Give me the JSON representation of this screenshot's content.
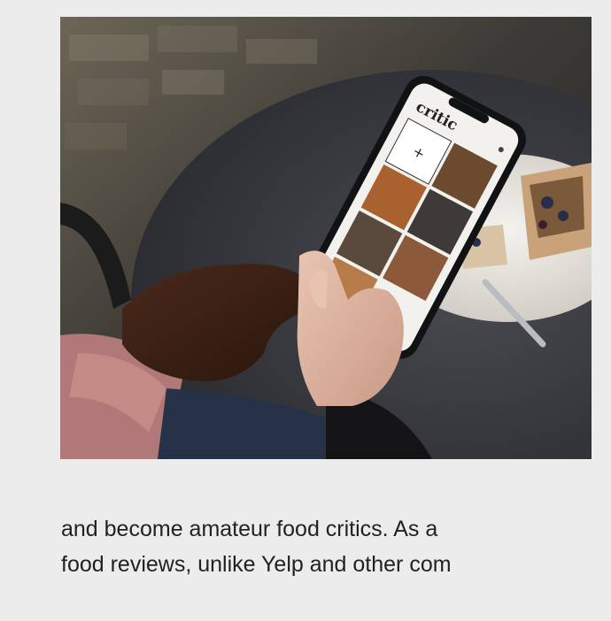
{
  "photo": {
    "alt": "",
    "app_logo_text": "critic",
    "add_symbol": "+"
  },
  "article": {
    "lines": [
      "and become amateur food critics. As a",
      "food reviews, unlike Yelp and other com"
    ]
  },
  "colors": {
    "page_background": "#ececec",
    "body_text": "#222222"
  }
}
